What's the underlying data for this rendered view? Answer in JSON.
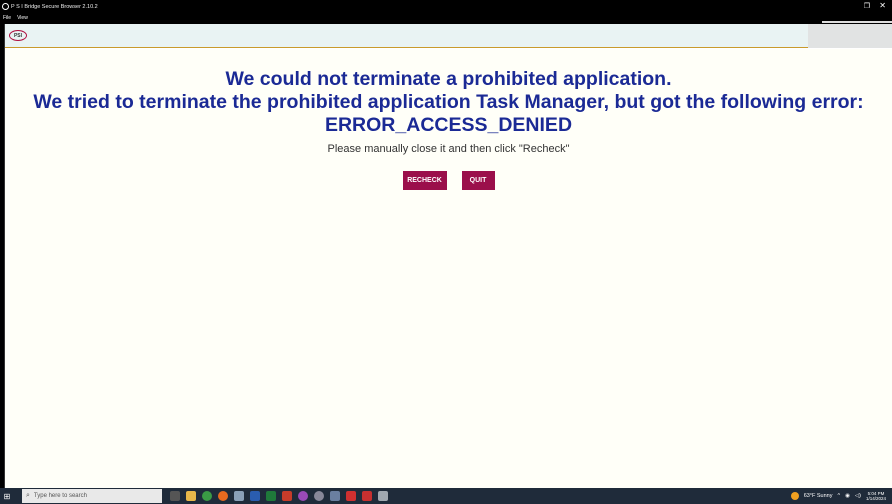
{
  "window": {
    "title": "P S I Bridge Secure Browser 2.10.2",
    "menu": [
      "File",
      "View"
    ],
    "restore_icon": "restore-icon",
    "close_icon": "close-icon"
  },
  "brand": {
    "logo_text": "PSI",
    "accent_color": "#9b0f4b",
    "heading_color": "#1b2a95"
  },
  "message": {
    "line1": "We could not terminate a prohibited application.",
    "line2": "We tried to terminate the prohibited application Task Manager, but got the following error:",
    "line3": "ERROR_ACCESS_DENIED",
    "instruction": "Please manually close it and then click \"Recheck\""
  },
  "buttons": {
    "recheck": "RECHECK",
    "quit": "QUIT"
  },
  "taskbar": {
    "search_placeholder": "Type here to search",
    "weather": "63°F  Sunny",
    "time": "5:04 PM",
    "date": "1/14/2024"
  }
}
